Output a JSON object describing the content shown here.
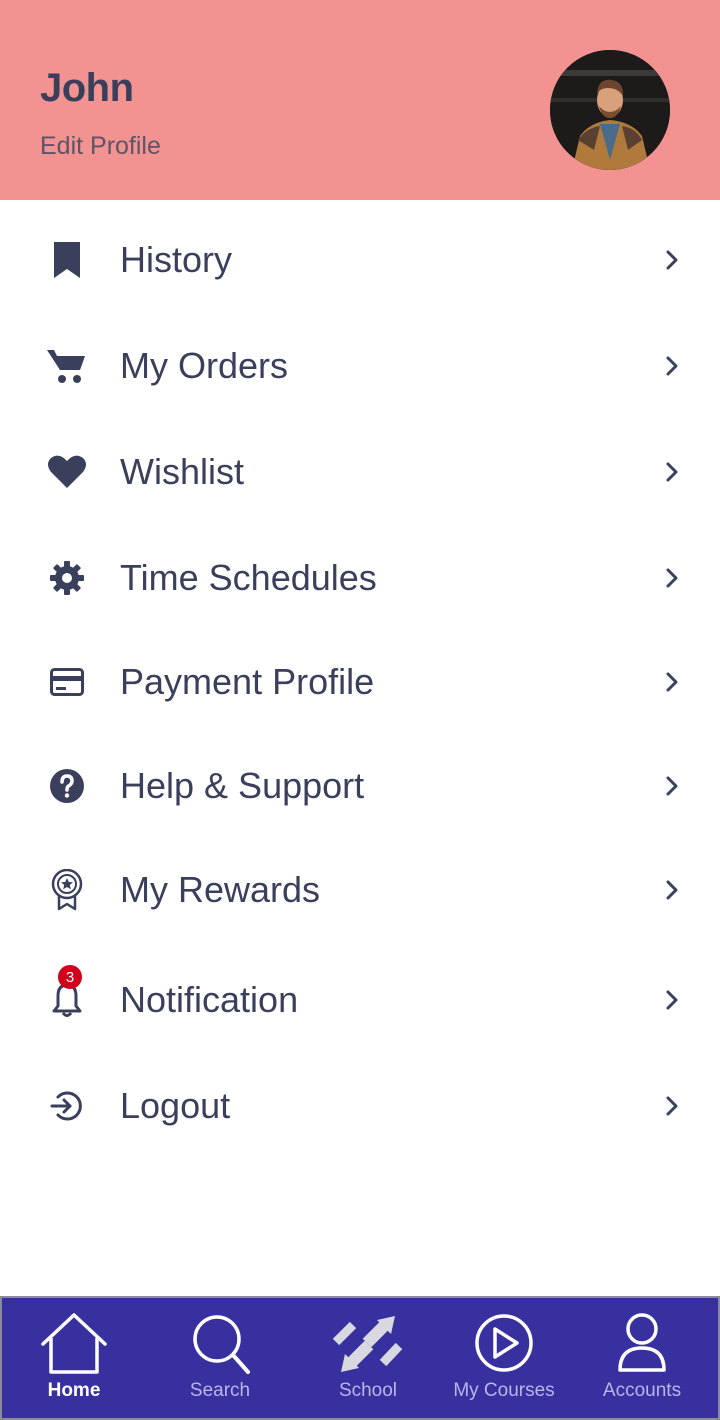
{
  "header": {
    "user_name": "John",
    "edit_profile": "Edit Profile",
    "background_color": "#f29391"
  },
  "menu": {
    "items": [
      {
        "label": "History",
        "icon": "bookmark-icon"
      },
      {
        "label": "My Orders",
        "icon": "cart-icon"
      },
      {
        "label": "Wishlist",
        "icon": "heart-icon"
      },
      {
        "label": "Time Schedules",
        "icon": "gear-icon"
      },
      {
        "label": "Payment Profile",
        "icon": "credit-card-icon"
      },
      {
        "label": "Help & Support",
        "icon": "question-circle-icon"
      },
      {
        "label": "My Rewards",
        "icon": "award-badge-icon"
      },
      {
        "label": "Notification",
        "icon": "bell-icon",
        "badge": "3"
      },
      {
        "label": "Logout",
        "icon": "logout-icon"
      }
    ],
    "text_color": "#3a3f5c",
    "badge_color": "#d0021b"
  },
  "bottom_nav": {
    "background_color": "#3930a0",
    "items": [
      {
        "label": "Home",
        "icon": "home-icon",
        "active": true
      },
      {
        "label": "Search",
        "icon": "search-icon",
        "active": false
      },
      {
        "label": "School",
        "icon": "school-arrows-icon",
        "active": false
      },
      {
        "label": "My Courses",
        "icon": "play-circle-icon",
        "active": false
      },
      {
        "label": "Accounts",
        "icon": "user-icon",
        "active": false
      }
    ]
  }
}
